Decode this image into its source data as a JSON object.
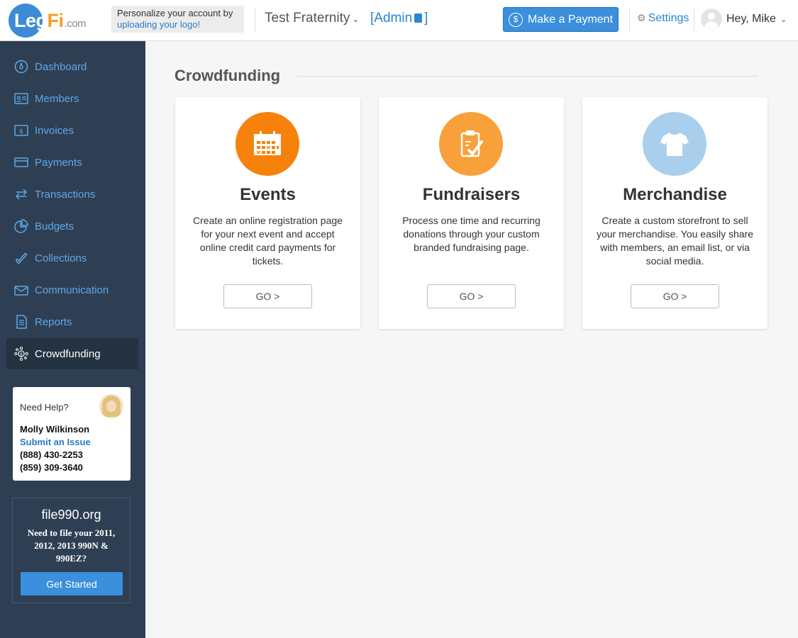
{
  "header": {
    "logo": {
      "part1": "Leg",
      "part2": "Fi",
      "part3": ".com"
    },
    "personalize": {
      "text": "Personalize your account by",
      "link": "uploading your logo!"
    },
    "org_name": "Test Fraternity",
    "admin_label": "[Admin",
    "admin_close": "]",
    "payment_button": "Make a Payment",
    "settings": "Settings",
    "user_greeting": "Hey, Mike"
  },
  "sidebar": {
    "items": [
      {
        "label": "Dashboard",
        "icon": "dashboard-icon"
      },
      {
        "label": "Members",
        "icon": "members-icon"
      },
      {
        "label": "Invoices",
        "icon": "invoices-icon"
      },
      {
        "label": "Payments",
        "icon": "payments-icon"
      },
      {
        "label": "Transactions",
        "icon": "transactions-icon"
      },
      {
        "label": "Budgets",
        "icon": "budgets-icon"
      },
      {
        "label": "Collections",
        "icon": "collections-icon"
      },
      {
        "label": "Communication",
        "icon": "communication-icon"
      },
      {
        "label": "Reports",
        "icon": "reports-icon"
      },
      {
        "label": "Crowdfunding",
        "icon": "crowdfunding-icon",
        "active": true
      }
    ],
    "help": {
      "title": "Need Help?",
      "name": "Molly Wilkinson",
      "link": "Submit an Issue",
      "phone1": "(888) 430-2253",
      "phone2": "(859) 309-3640"
    },
    "file990": {
      "title": "file990.org",
      "text": "Need to file your 2011, 2012, 2013 990N & 990EZ?",
      "button": "Get Started"
    }
  },
  "main": {
    "title": "Crowdfunding",
    "cards": [
      {
        "title": "Events",
        "description": "Create an online registration page for your next event and accept online credit card payments for tickets.",
        "button": "GO >",
        "icon": "calendar-icon",
        "color": "#f6820c"
      },
      {
        "title": "Fundraisers",
        "description": "Process one time and recurring donations through your custom branded fundraising page.",
        "button": "GO >",
        "icon": "clipboard-check-icon",
        "color": "#f8a13a"
      },
      {
        "title": "Merchandise",
        "description": "Create a custom storefront to sell your merchandise. You easily share with members, an email list, or via social media.",
        "button": "GO >",
        "icon": "tshirt-icon",
        "color": "#a9cfec"
      }
    ]
  },
  "colors": {
    "sidebar_bg": "#2e3f54",
    "accent_blue": "#3b8fdc",
    "nav_text": "#5fa8e6"
  }
}
